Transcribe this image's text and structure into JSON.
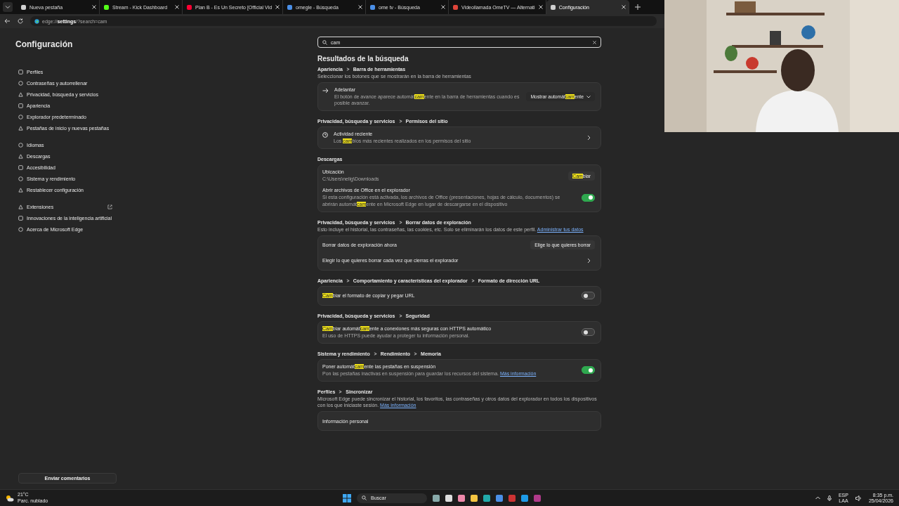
{
  "tabs": [
    {
      "title": "Nueva pestaña",
      "selected": false,
      "color": "#d0d0d0"
    },
    {
      "title": "Stream - Kick Dashboard",
      "selected": false,
      "color": "#53fc18"
    },
    {
      "title": "Plan B - Es Un Secreto [Official Vid",
      "selected": false,
      "color": "#ff0033"
    },
    {
      "title": "omegle - Búsqueda",
      "selected": false,
      "color": "#4a8fe7"
    },
    {
      "title": "ome tv - Búsqueda",
      "selected": false,
      "color": "#4a8fe7"
    },
    {
      "title": "Videollamada OmeTV — Alternati",
      "selected": false,
      "color": "#e0453a"
    },
    {
      "title": "Configuración",
      "selected": true,
      "color": "#cfcfcf"
    }
  ],
  "address": "edge://**settings**/?search=cam",
  "sidebar": {
    "title": "Configuración",
    "groups": [
      [
        {
          "label": "Perfiles"
        },
        {
          "label": "Contraseñas y autorrellenar"
        },
        {
          "label": "Privacidad, búsqueda y servicios"
        },
        {
          "label": "Apariencia"
        },
        {
          "label": "Explorador predeterminado"
        },
        {
          "label": "Pestañas de inicio y nuevas pestañas"
        }
      ],
      [
        {
          "label": "Idiomas"
        },
        {
          "label": "Descargas"
        },
        {
          "label": "Accesibilidad"
        },
        {
          "label": "Sistema y rendimiento"
        },
        {
          "label": "Restablecer configuración"
        }
      ],
      [
        {
          "label": "Extensiones",
          "external": true
        },
        {
          "label": "Innovaciones de la inteligencia artificial",
          "external": false
        },
        {
          "label": "Acerca de Microsoft Edge",
          "external": false
        }
      ]
    ],
    "feedback": "Enviar comentarios"
  },
  "search": {
    "value": "cam"
  },
  "heading": "Resultados de la búsqueda",
  "sections": [
    {
      "breadcrumb": [
        "Apariencia",
        "Barra de herramientas"
      ],
      "description": [
        {
          "kind": "text",
          "t": "Seleccionar los botones que se mostrarán en la barra de herramientas"
        }
      ],
      "rows": [
        {
          "kind": "dropdown",
          "title": [
            {
              "kind": "text",
              "t": "Adelantar"
            }
          ],
          "description": [
            {
              "kind": "text",
              "t": "El botón de avance aparece automát"
            },
            {
              "kind": "highlight",
              "t": "cam"
            },
            {
              "kind": "text",
              "t": "ente en la barra de herramientas cuando es posible avanzar."
            }
          ],
          "value": [
            {
              "kind": "text",
              "t": "Mostrar automát"
            },
            {
              "kind": "highlight",
              "t": "cam"
            },
            {
              "kind": "text",
              "t": "ente"
            }
          ]
        }
      ]
    },
    {
      "breadcrumb": [
        "Privacidad, búsqueda y servicios",
        "Permisos del sitio"
      ],
      "rows": [
        {
          "kind": "link",
          "title": [
            {
              "kind": "text",
              "t": "Actividad reciente"
            }
          ],
          "description": [
            {
              "kind": "text",
              "t": "Los "
            },
            {
              "kind": "highlight",
              "t": "cam"
            },
            {
              "kind": "text",
              "t": "bios más recientes realizados en los permisos del sitio"
            }
          ]
        }
      ]
    },
    {
      "breadcrumb": [
        "Descargas"
      ],
      "rows": [
        {
          "kind": "button",
          "title": [
            {
              "kind": "text",
              "t": "Ubicación"
            }
          ],
          "description": [
            {
              "kind": "text",
              "t": "C:\\Users\\nelig\\Downloads"
            }
          ],
          "value": [
            {
              "kind": "highlight",
              "t": "Cam"
            },
            {
              "kind": "text",
              "t": "biar"
            }
          ]
        },
        {
          "kind": "toggle",
          "on": true,
          "title": [
            {
              "kind": "text",
              "t": "Abrir archivos de Office en el explorador"
            }
          ],
          "description": [
            {
              "kind": "text",
              "t": "Si esta configuración está activada, los archivos de Office (presentaciones, hojas de cálculo, documentos) se abrirán automát"
            },
            {
              "kind": "highlight",
              "t": "cam"
            },
            {
              "kind": "text",
              "t": "ente en Microsoft Edge en lugar de descargarse en el dispositivo"
            }
          ]
        }
      ]
    },
    {
      "breadcrumb": [
        "Privacidad, búsqueda y servicios",
        "Borrar datos de exploración"
      ],
      "description": [
        {
          "kind": "text",
          "t": "Esto incluye el historial, las contraseñas, las cookies, etc. Solo se eliminarán los datos de este perfil. "
        },
        {
          "kind": "link",
          "t": "Administrar tus datos"
        }
      ],
      "rows": [
        {
          "kind": "button",
          "title": [
            {
              "kind": "text",
              "t": "Borrar datos de exploración ahora"
            }
          ],
          "value": [
            {
              "kind": "text",
              "t": "Elige lo que quieres borrar"
            }
          ]
        },
        {
          "kind": "link",
          "title": [
            {
              "kind": "text",
              "t": "Elegir lo que quieres borrar cada vez que cierras el explorador"
            }
          ]
        }
      ]
    },
    {
      "breadcrumb": [
        "Apariencia",
        "Comportamiento y características del explorador",
        "Formato de dirección URL"
      ],
      "rows": [
        {
          "kind": "toggle",
          "on": false,
          "title": [
            {
              "kind": "highlight",
              "t": "Cam"
            },
            {
              "kind": "text",
              "t": "biar el formato de copiar y pegar URL"
            }
          ]
        }
      ]
    },
    {
      "breadcrumb": [
        "Privacidad, búsqueda y servicios",
        "Seguridad"
      ],
      "rows": [
        {
          "kind": "toggle",
          "on": false,
          "title": [
            {
              "kind": "highlight",
              "t": "Cam"
            },
            {
              "kind": "text",
              "t": "biar automát"
            },
            {
              "kind": "highlight",
              "t": "cam"
            },
            {
              "kind": "text",
              "t": "ente a conexiones más seguras con HTTPS automático"
            }
          ],
          "description": [
            {
              "kind": "text",
              "t": "El uso de HTTPS puede ayudar a proteger tu información personal."
            }
          ]
        }
      ]
    },
    {
      "breadcrumb": [
        "Sistema y rendimiento",
        "Rendimiento",
        "Memoria"
      ],
      "rows": [
        {
          "kind": "toggle",
          "on": true,
          "title": [
            {
              "kind": "text",
              "t": "Poner automát"
            },
            {
              "kind": "highlight",
              "t": "cam"
            },
            {
              "kind": "text",
              "t": "ente las pestañas en suspensión"
            }
          ],
          "description": [
            {
              "kind": "text",
              "t": "Pon las pestañas inactivas en suspensión para guardar los recursos del sistema. "
            },
            {
              "kind": "link",
              "t": "Más información"
            }
          ]
        }
      ]
    },
    {
      "breadcrumb": [
        "Perfiles",
        "Sincronizar"
      ],
      "description": [
        {
          "kind": "text",
          "t": "Microsoft Edge puede sincronizar el historial, los favoritos, las contraseñas y otros datos del explorador en todos los dispositivos con los que iniciaste sesión. "
        },
        {
          "kind": "link",
          "t": "Más información"
        }
      ],
      "rows": [
        {
          "kind": "plain",
          "title": [
            {
              "kind": "text",
              "t": "Información personal"
            }
          ]
        }
      ]
    }
  ],
  "taskbar": {
    "temperature": "21°C",
    "weather": "Parc. nublado",
    "search": "Buscar",
    "language": "ESP",
    "layout": "LAA",
    "time": "8:35 p.m.",
    "date": "25/04/2026"
  }
}
